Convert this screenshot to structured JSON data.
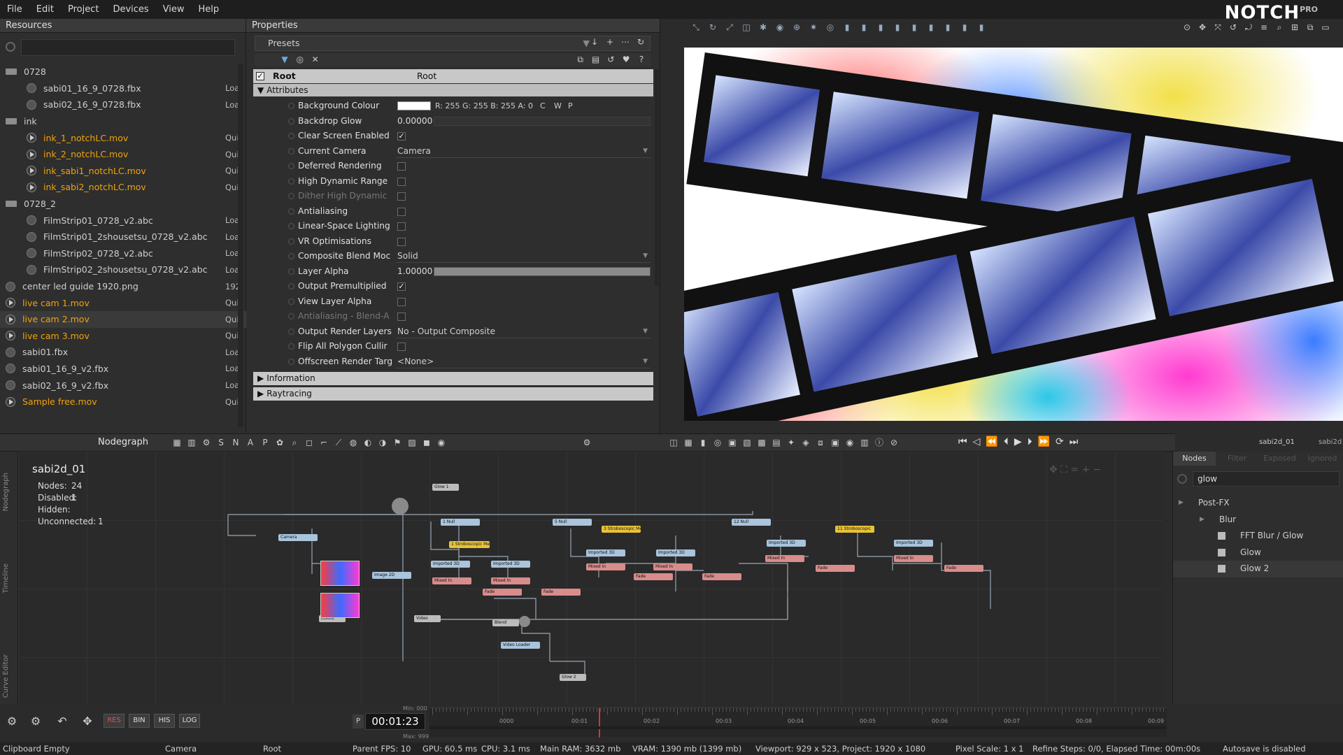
{
  "menu": [
    "File",
    "Edit",
    "Project",
    "Devices",
    "View",
    "Help"
  ],
  "brand": {
    "name": "NOTCH",
    "edition": "PRO"
  },
  "resources": {
    "title": "Resources",
    "items": [
      {
        "name": "0728",
        "type": "folder",
        "status": ""
      },
      {
        "name": "sabi01_16_9_0728.fbx",
        "type": "file",
        "status": "Loa"
      },
      {
        "name": "sabi02_16_9_0728.fbx",
        "type": "file",
        "status": "Loa"
      },
      {
        "name": "ink",
        "type": "folder",
        "status": ""
      },
      {
        "name": "ink_1_notchLC.mov",
        "type": "video",
        "status": "Qui",
        "orange": true
      },
      {
        "name": "ink_2_notchLC.mov",
        "type": "video",
        "status": "Qui",
        "orange": true
      },
      {
        "name": "ink_sabi1_notchLC.mov",
        "type": "video",
        "status": "Qui",
        "orange": true
      },
      {
        "name": "ink_sabi2_notchLC.mov",
        "type": "video",
        "status": "Qui",
        "orange": true
      },
      {
        "name": "0728_2",
        "type": "folder",
        "status": ""
      },
      {
        "name": "FilmStrip01_0728_v2.abc",
        "type": "file",
        "status": "Loa"
      },
      {
        "name": "FilmStrip01_2shousetsu_0728_v2.abc",
        "type": "file",
        "status": "Loa"
      },
      {
        "name": "FilmStrip02_0728_v2.abc",
        "type": "file",
        "status": "Loa"
      },
      {
        "name": "FilmStrip02_2shousetsu_0728_v2.abc",
        "type": "file",
        "status": "Loa"
      },
      {
        "name": "center led guide 1920.png",
        "type": "image",
        "status": "192"
      },
      {
        "name": "live cam 1.mov",
        "type": "video",
        "status": "Qui",
        "orange": true
      },
      {
        "name": "live cam 2.mov",
        "type": "video",
        "status": "Qui",
        "orange": true,
        "selected": true
      },
      {
        "name": "live cam 3.mov",
        "type": "video",
        "status": "Qui",
        "orange": true
      },
      {
        "name": "sabi01.fbx",
        "type": "file",
        "status": "Loa"
      },
      {
        "name": "sabi01_16_9_v2.fbx",
        "type": "file",
        "status": "Loa"
      },
      {
        "name": "sabi02_16_9_v2.fbx",
        "type": "file",
        "status": "Loa"
      },
      {
        "name": "Sample free.mov",
        "type": "video",
        "status": "Qui",
        "orange": true
      }
    ]
  },
  "properties": {
    "title": "Properties",
    "presets": "Presets",
    "root_label": "Root",
    "root_value": "Root",
    "attributes": "Attributes",
    "rows": [
      {
        "label": "Background Colour",
        "kind": "color",
        "value": "R: 255 G: 255 B: 255 A: 0",
        "extra": [
          "C",
          "W",
          "P"
        ]
      },
      {
        "label": "Backdrop Glow",
        "kind": "number",
        "value": "0.00000"
      },
      {
        "label": "Clear Screen Enabled",
        "kind": "check",
        "checked": true
      },
      {
        "label": "Current Camera",
        "kind": "dropdown",
        "value": "Camera"
      },
      {
        "label": "Deferred Rendering",
        "kind": "check",
        "checked": false
      },
      {
        "label": "High Dynamic Range",
        "kind": "check",
        "checked": false
      },
      {
        "label": "Dither High Dynamic",
        "kind": "check",
        "checked": false,
        "dim": true
      },
      {
        "label": "Antialiasing",
        "kind": "check",
        "checked": false
      },
      {
        "label": "Linear-Space Lighting",
        "kind": "check",
        "checked": false
      },
      {
        "label": "VR Optimisations",
        "kind": "check",
        "checked": false
      },
      {
        "label": "Composite Blend Moc",
        "kind": "dropdown",
        "value": "Solid"
      },
      {
        "label": "Layer Alpha",
        "kind": "slider",
        "value": "1.00000",
        "level": 1
      },
      {
        "label": "Output Premultiplied",
        "kind": "check",
        "checked": true
      },
      {
        "label": "View Layer Alpha",
        "kind": "check",
        "checked": false
      },
      {
        "label": "Antialiasing - Blend-A",
        "kind": "check",
        "checked": false,
        "dim": true
      },
      {
        "label": "Output Render Layers",
        "kind": "dropdown",
        "value": "No - Output Composite"
      },
      {
        "label": "Flip All Polygon Cullir",
        "kind": "check",
        "checked": false
      },
      {
        "label": "Offscreen Render Targ",
        "kind": "dropdown",
        "value": "<None>"
      }
    ],
    "sections": [
      "Information",
      "Raytracing"
    ]
  },
  "nodegraph": {
    "tab": "Nodegraph",
    "graph_name": "sabi2d_01",
    "stats": [
      {
        "k": "Nodes:",
        "v": "24"
      },
      {
        "k": "Disabled:",
        "v": "1"
      },
      {
        "k": "Hidden:",
        "v": ""
      },
      {
        "k": "Unconnected:",
        "v": "1"
      }
    ],
    "side_tabs": [
      "Nodegraph",
      "Timeline",
      "Curve Editor"
    ],
    "layer_name": "sabi2d_01",
    "layer_name2": "sabi2d"
  },
  "nodes_panel": {
    "tabs": [
      "Nodes",
      "Filter",
      "Exposed",
      "Ignored"
    ],
    "search": "glow",
    "tree": [
      {
        "label": "Post-FX",
        "level": 0
      },
      {
        "label": "Blur",
        "level": 1
      },
      {
        "label": "FFT Blur / Glow",
        "level": 2
      },
      {
        "label": "Glow",
        "level": 2
      },
      {
        "label": "Glow 2",
        "level": 2
      }
    ]
  },
  "transport": {
    "timecode": "00:01:23",
    "min": "Min: 000",
    "max": "Max: 999",
    "p": "P",
    "ticks": [
      "0000",
      "00:01",
      "00:02",
      "00:03",
      "00:04",
      "00:05",
      "00:06",
      "00:07",
      "00:08",
      "00:09"
    ],
    "playhead": 0.23
  },
  "bottom_buttons": [
    "RES",
    "BIN",
    "HIS",
    "LOG"
  ],
  "status": {
    "clipboard": "Clipboard Empty",
    "camera": "Camera",
    "root": "Root",
    "fps": "Parent FPS: 10",
    "gpu": "GPU: 60.5 ms",
    "cpu": "CPU: 3.1 ms",
    "ram": "Main RAM: 3632 mb",
    "vram": "VRAM: 1390 mb (1399 mb)",
    "viewport": "Viewport: 929 x 523, Project: 1920 x 1080",
    "pixel": "Pixel Scale: 1 x 1",
    "refine": "Refine Steps: 0/0, Elapsed Time: 00m:00s",
    "autosave": "Autosave is disabled"
  },
  "colors": {
    "accent": "#f0a30a",
    "node_blue": "#a9c4dc",
    "node_red": "#d98c8c",
    "node_yellow": "#e8c338"
  }
}
